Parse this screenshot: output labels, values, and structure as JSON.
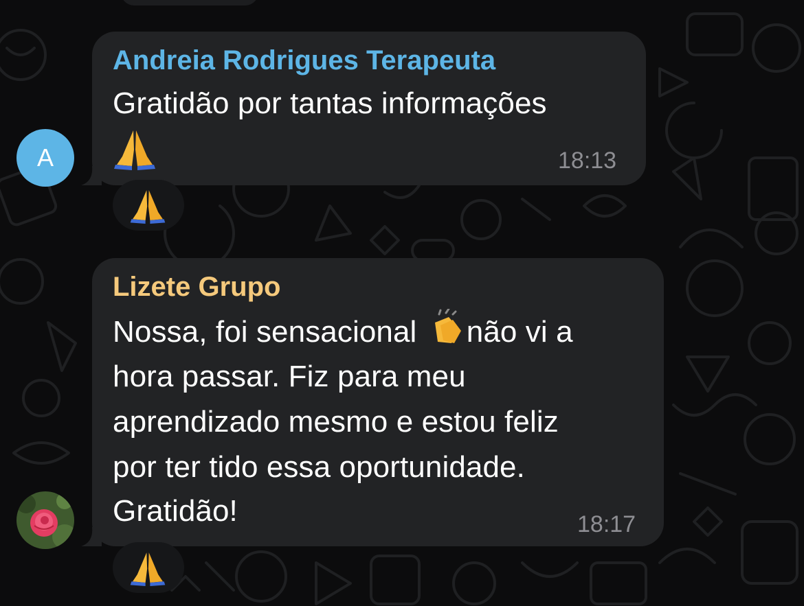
{
  "messages": [
    {
      "sender": "Andreia Rodrigues Terapeuta",
      "sender_color": "#5db5e6",
      "text_line1": "Gratidão por tantas informações",
      "time": "18:13",
      "avatar_letter": "A",
      "reaction_icon": "praying-hands-emoji"
    },
    {
      "sender": "Lizete Grupo",
      "sender_color": "#f5c97c",
      "text_line1_a": "Nossa, foi sensacional ",
      "text_line1_b": "não vi a",
      "text_line2": "hora passar. Fiz para meu",
      "text_line3": "aprendizado mesmo e estou feliz",
      "text_line4": "por ter tido essa oportunidade.",
      "text_line5": "Gratidão!",
      "time": "18:17",
      "avatar_icon": "rose-photo",
      "reaction_icon": "praying-hands-emoji"
    }
  ],
  "colors": {
    "background": "#0c0c0d",
    "bubble": "#222325",
    "time_text": "#8e8e93"
  }
}
